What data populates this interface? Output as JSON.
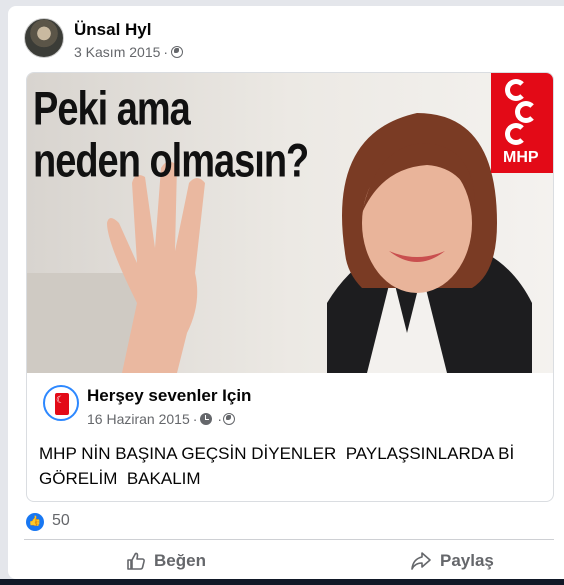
{
  "post": {
    "author": "Ünsal Hyl",
    "date": "3 Kasım 2015",
    "separator": "·",
    "privacy_icon": "globe-icon"
  },
  "image": {
    "caption_line1": "Peki ama",
    "caption_line2": "neden olmasın?",
    "logo_text": "MHP"
  },
  "shared_post": {
    "page_name": "Herşey sevenler Için",
    "date": "16 Haziran 2015",
    "separator": "·",
    "text": "MHP NİN BAŞINA GEÇSİN DİYENLER  PAYLAŞSINLARDA Bİ GÖRELİM  BAKALIM"
  },
  "reactions": {
    "count": "50",
    "icon": "like-icon"
  },
  "actions": {
    "like_label": "Beğen",
    "share_label": "Paylaş"
  },
  "colors": {
    "accent": "#1877f2",
    "mhp_red": "#e30a17",
    "secondary_text": "#65676b"
  }
}
